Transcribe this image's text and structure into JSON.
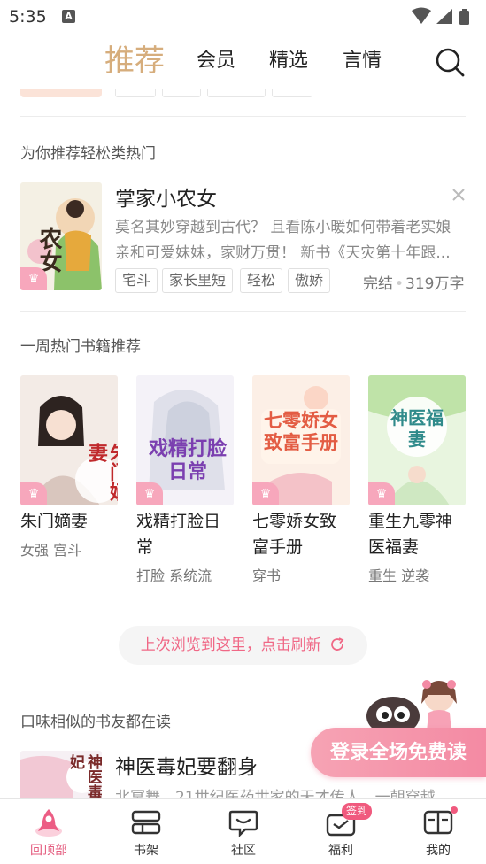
{
  "status_bar": {
    "time": "5:35",
    "notification_icon": "A"
  },
  "top_nav": {
    "tabs": [
      {
        "label": "推荐",
        "active": true
      },
      {
        "label": "会员",
        "active": false
      },
      {
        "label": "精选",
        "active": false
      },
      {
        "label": "言情",
        "active": false
      }
    ],
    "search_icon": "search-icon",
    "accent_color": "#d6ad7c"
  },
  "sections": {
    "relaxed": {
      "title": "为你推荐轻松类热门",
      "book": {
        "title": "掌家小农女",
        "cover_text": "农女",
        "description": "莫名其妙穿越到古代？ 且看陈小暖如何带着老实娘亲和可爱妹妹，家财万贯！ 新书《天灾第十年跟...",
        "tags": [
          "宅斗",
          "家长里短",
          "轻松",
          "傲娇"
        ],
        "status": "完结",
        "word_count": "319万字"
      }
    },
    "weekly": {
      "title": "一周热门书籍推荐",
      "books": [
        {
          "title": "朱门嫡妻",
          "cover_text": "朱门嫡妻",
          "tags": "女强 宫斗"
        },
        {
          "title": "戏精打脸日常",
          "cover_text": "戏精打脸日常",
          "tags": "打脸 系统流"
        },
        {
          "title": "七零娇女致富手册",
          "cover_text": "七零娇女致富手册",
          "tags": "穿书"
        },
        {
          "title": "重生九零神医福妻",
          "cover_text": "神医福妻",
          "tags": "重生 逆袭"
        }
      ]
    },
    "refresh": {
      "label": "上次浏览到这里，点击刷新"
    },
    "similar": {
      "title": "口味相似的书友都在读",
      "book": {
        "title": "神医毒妃要翻身",
        "cover_text": "神医毒妃",
        "description": "北冥舞，21世纪医药世家的天才传人，一朝穿越"
      }
    }
  },
  "promo": {
    "label": "登录全场免费读"
  },
  "bottom_nav": {
    "items": [
      {
        "label": "回顶部",
        "icon": "rocket-icon",
        "active": true
      },
      {
        "label": "书架",
        "icon": "bookshelf-icon",
        "active": false
      },
      {
        "label": "社区",
        "icon": "chat-icon",
        "active": false
      },
      {
        "label": "福利",
        "icon": "gift-icon",
        "active": false,
        "badge": "签到"
      },
      {
        "label": "我的",
        "icon": "profile-icon",
        "active": false,
        "dot": true
      }
    ],
    "active_color": "#e45b7e"
  }
}
